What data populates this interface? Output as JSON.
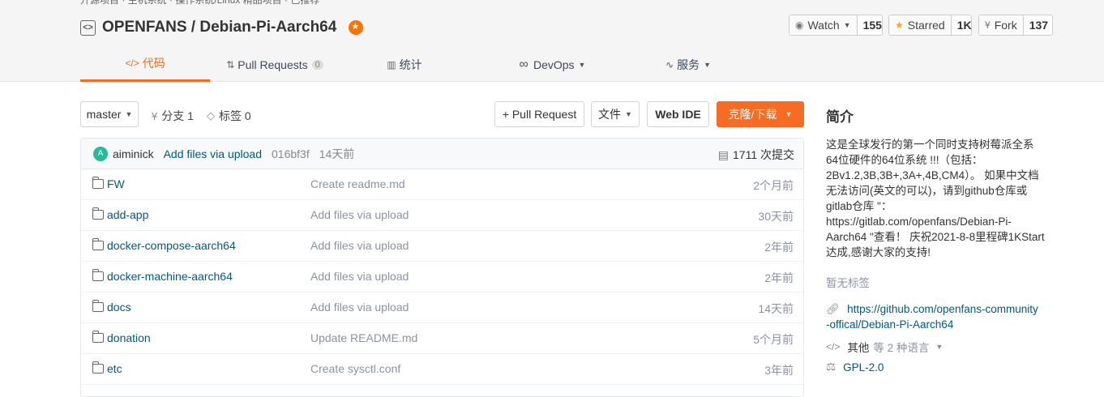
{
  "topbar": {
    "crumb": "开源项目 · 主机系统 · 操作系统/Linux 精品项目 · 已推荐"
  },
  "repo": {
    "owner": "OPENFANS",
    "separator": " / ",
    "name": "Debian-Pi-Aarch64"
  },
  "actions": {
    "watch": {
      "label": "Watch",
      "count": "155"
    },
    "star": {
      "label": "Starred",
      "count": "1K"
    },
    "fork": {
      "label": "Fork",
      "count": "137"
    }
  },
  "tabs": [
    {
      "label": "代码",
      "icon": "code-icon"
    },
    {
      "label": "Pull Requests",
      "count": "0",
      "icon": "pull-request-icon"
    },
    {
      "label": "统计",
      "icon": "bar-chart-icon"
    },
    {
      "label": "DevOps",
      "icon": "infinity-icon"
    },
    {
      "label": "服务",
      "icon": "pulse-icon"
    }
  ],
  "toolbar": {
    "branch": "master",
    "branches": "分支 1",
    "tags": "标签 0",
    "pull_request": "+ Pull Request",
    "file": "文件",
    "web_ide": "Web IDE",
    "clone": "克隆/下载"
  },
  "commit": {
    "avatar": "A",
    "author": "aiminick",
    "message": "Add files via upload",
    "sha": "016bf3f",
    "time": "14天前",
    "total": "1711 次提交"
  },
  "files": [
    {
      "name": "FW",
      "message": "Create readme.md",
      "time": "2个月前"
    },
    {
      "name": "add-app",
      "message": "Add files via upload",
      "time": "30天前"
    },
    {
      "name": "docker-compose-aarch64",
      "message": "Add files via upload",
      "time": "2年前"
    },
    {
      "name": "docker-machine-aarch64",
      "message": "Add files via upload",
      "time": "2年前"
    },
    {
      "name": "docs",
      "message": "Add files via upload",
      "time": "14天前"
    },
    {
      "name": "donation",
      "message": "Update README.md",
      "time": "5个月前"
    },
    {
      "name": "etc",
      "message": "Create sysctl.conf",
      "time": "3年前"
    }
  ],
  "sidebar": {
    "title": "简介",
    "description_lines": [
      "这是全球发行的第一个同时支持树莓派全系",
      "64位硬件的64位系统 !!!（包括：",
      "2Bv1.2,3B,3B+,3A+,4B,CM4）。 如果中文档",
      "无法访问(英文的可以)，请到github仓库或",
      "gitlab仓库 \"：",
      "https://gitlab.com/openfans/Debian-Pi-",
      "Aarch64 \"查看！ 庆祝2021-8-8里程碑1KStart",
      "达成,感谢大家的支持!"
    ],
    "no_tags": "暂无标签",
    "homepage_lines": [
      "https://github.com/openfans-community",
      "-offical/Debian-Pi-Aarch64"
    ],
    "languages": {
      "primary": "其他",
      "more": "等 2 种语言"
    },
    "license": "GPL-2.0"
  },
  "colors": {
    "accent": "#f56c22",
    "link": "#005980",
    "muted": "#8c92a4"
  }
}
